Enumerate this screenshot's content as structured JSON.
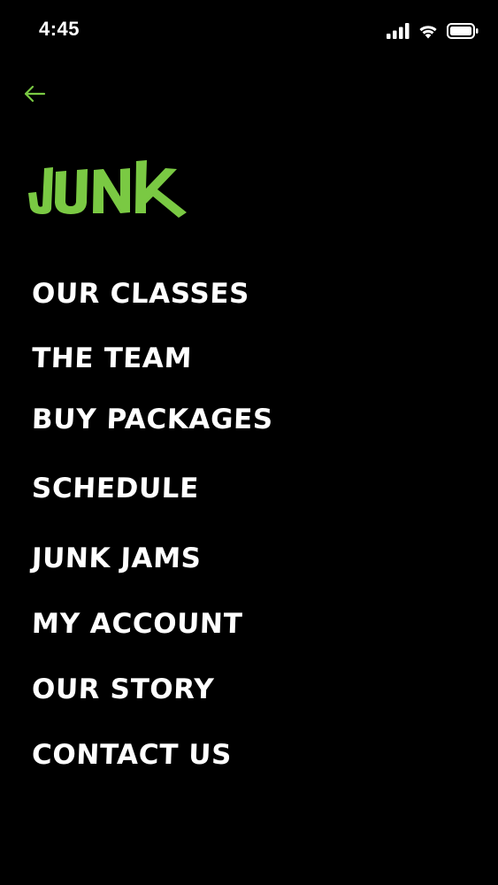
{
  "status_bar": {
    "time": "4:45",
    "icons": [
      "cellular-signal-icon",
      "wifi-icon",
      "battery-icon"
    ]
  },
  "nav": {
    "back_icon": "arrow-left-icon"
  },
  "logo": {
    "text": "JUNK",
    "color": "#7ac943"
  },
  "menu": {
    "items": [
      {
        "label": "OUR CLASSES"
      },
      {
        "label": "THE TEAM"
      },
      {
        "label": "BUY PACKAGES"
      },
      {
        "label": "SCHEDULE"
      },
      {
        "label": "JUNK JAMS"
      },
      {
        "label": "MY ACCOUNT"
      },
      {
        "label": "OUR STORY"
      },
      {
        "label": "CONTACT US"
      }
    ]
  },
  "colors": {
    "background": "#000000",
    "text": "#ffffff",
    "accent": "#7ac943"
  }
}
